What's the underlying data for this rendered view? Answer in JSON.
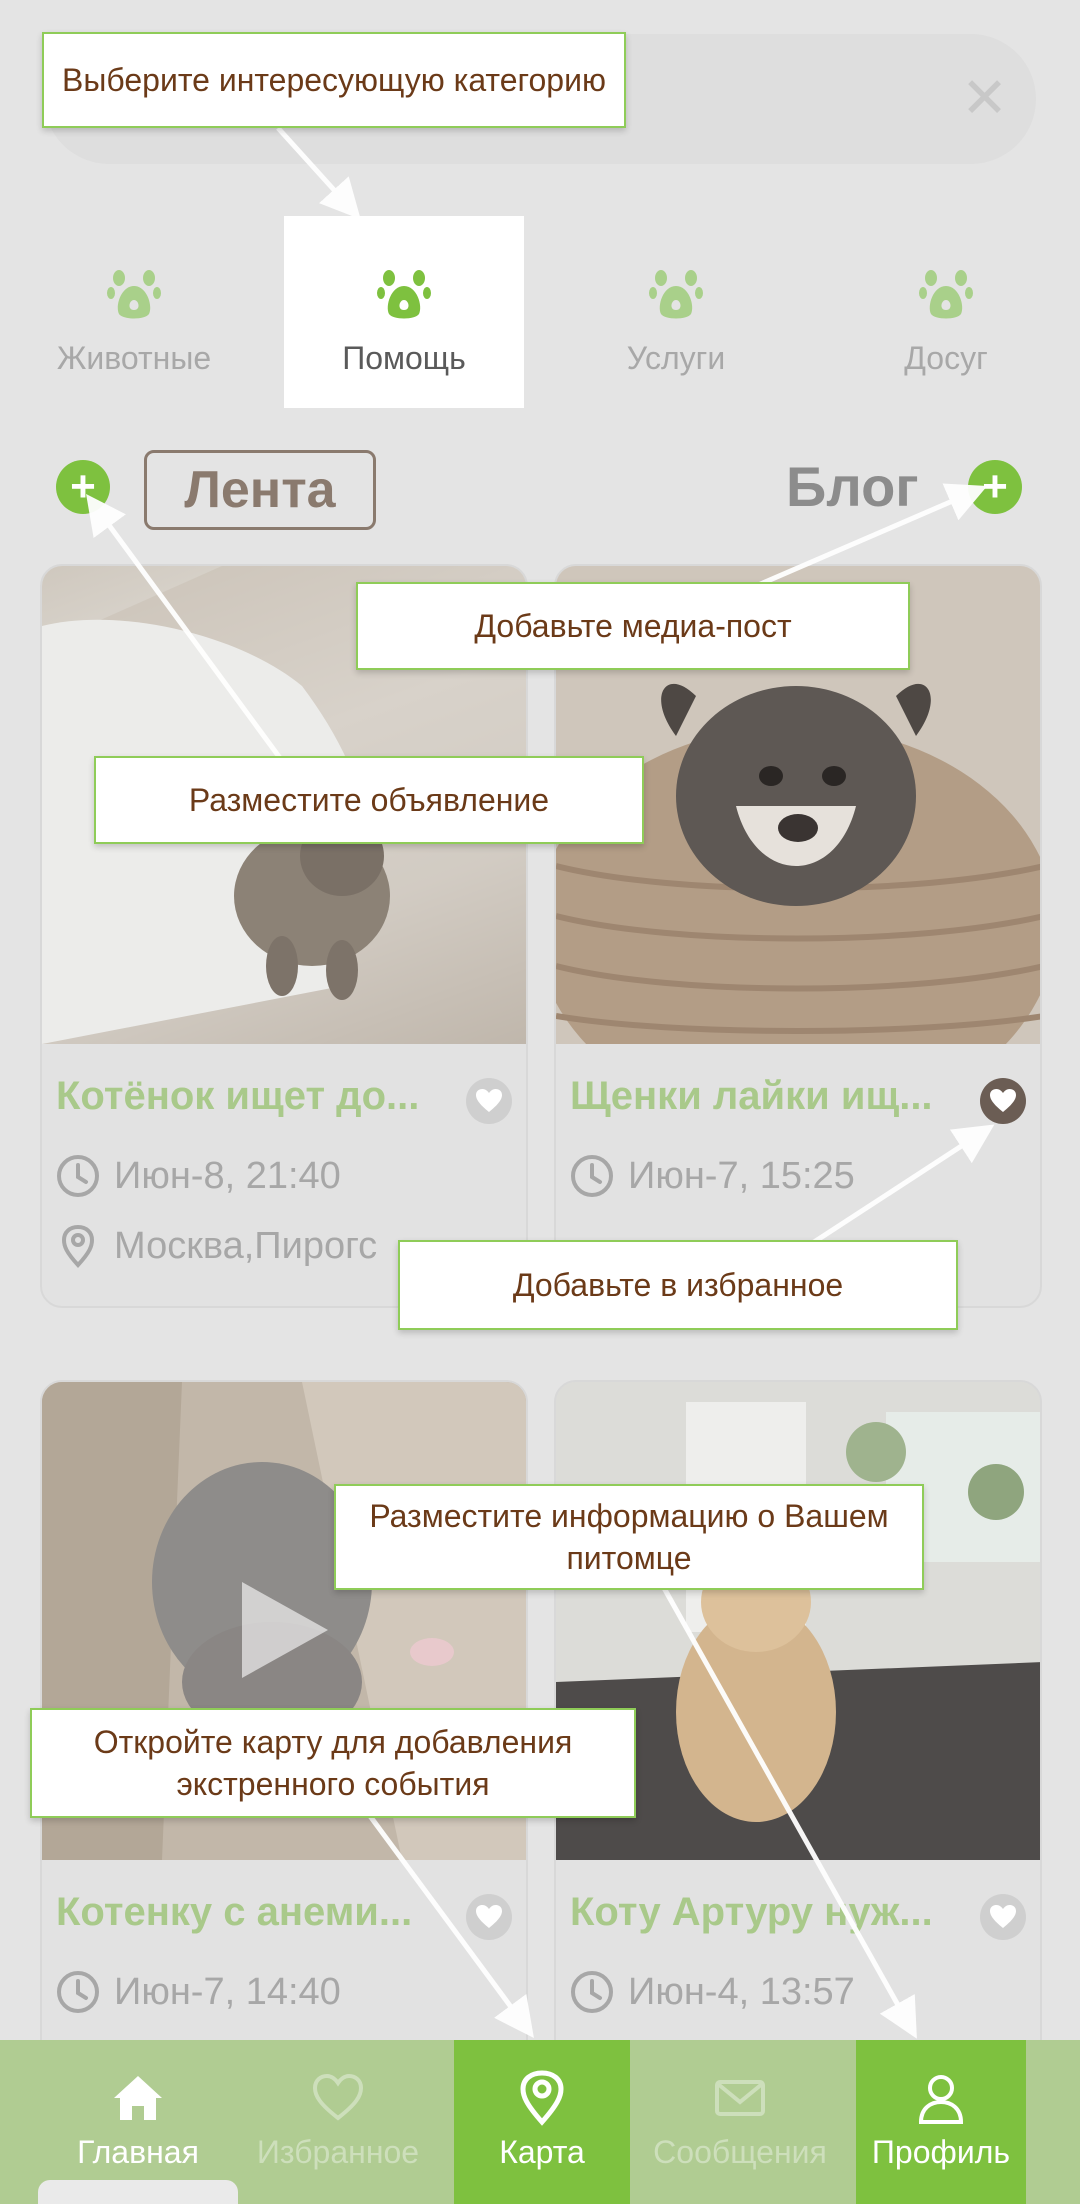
{
  "search": {
    "close_glyph": "✕"
  },
  "categories": [
    {
      "label": "Животные",
      "icon": "paw-icon",
      "active": false
    },
    {
      "label": "Помощь",
      "icon": "paw-icon",
      "active": true
    },
    {
      "label": "Услуги",
      "icon": "paw-icon",
      "active": false
    },
    {
      "label": "Досуг",
      "icon": "paw-icon",
      "active": false
    }
  ],
  "feed_tabs": {
    "feed": "Лента",
    "blog": "Блог",
    "add_glyph": "+"
  },
  "cards": [
    {
      "title": "Котёнок ищет до...",
      "date": "Июн-8, 21:40",
      "location": "Москва,Пирогс",
      "favorite": false,
      "photo": "kitten"
    },
    {
      "title": "Щенки лайки ищ...",
      "date": "Июн-7, 15:25",
      "location": "",
      "favorite": true,
      "photo": "puppy"
    },
    {
      "title": "Котенку с анеми...",
      "date": "Июн-7, 14:40",
      "location": "",
      "favorite": false,
      "photo": "cat-video"
    },
    {
      "title": "Коту Артуру нуж...",
      "date": "Июн-4, 13:57",
      "location": "",
      "favorite": false,
      "photo": "ginger-cat"
    }
  ],
  "bottom_nav": [
    {
      "label": "Главная",
      "icon": "home-icon"
    },
    {
      "label": "Избранное",
      "icon": "heart-icon"
    },
    {
      "label": "Карта",
      "icon": "map-pin-icon"
    },
    {
      "label": "Сообщения",
      "icon": "envelope-icon"
    },
    {
      "label": "Профиль",
      "icon": "user-icon"
    }
  ],
  "tips": {
    "category": "Выберите интересующую категорию",
    "media_post": "Добавьте медиа-пост",
    "ad": "Разместите объявление",
    "favorite": "Добавьте в избранное",
    "pet_info": "Разместите информацию о Вашем питомце",
    "map": "Откройте карту для добавления экстренного события"
  },
  "colors": {
    "accent": "#7ec13f",
    "tip_border": "#8fcc58",
    "tip_text": "#6b3a18"
  }
}
